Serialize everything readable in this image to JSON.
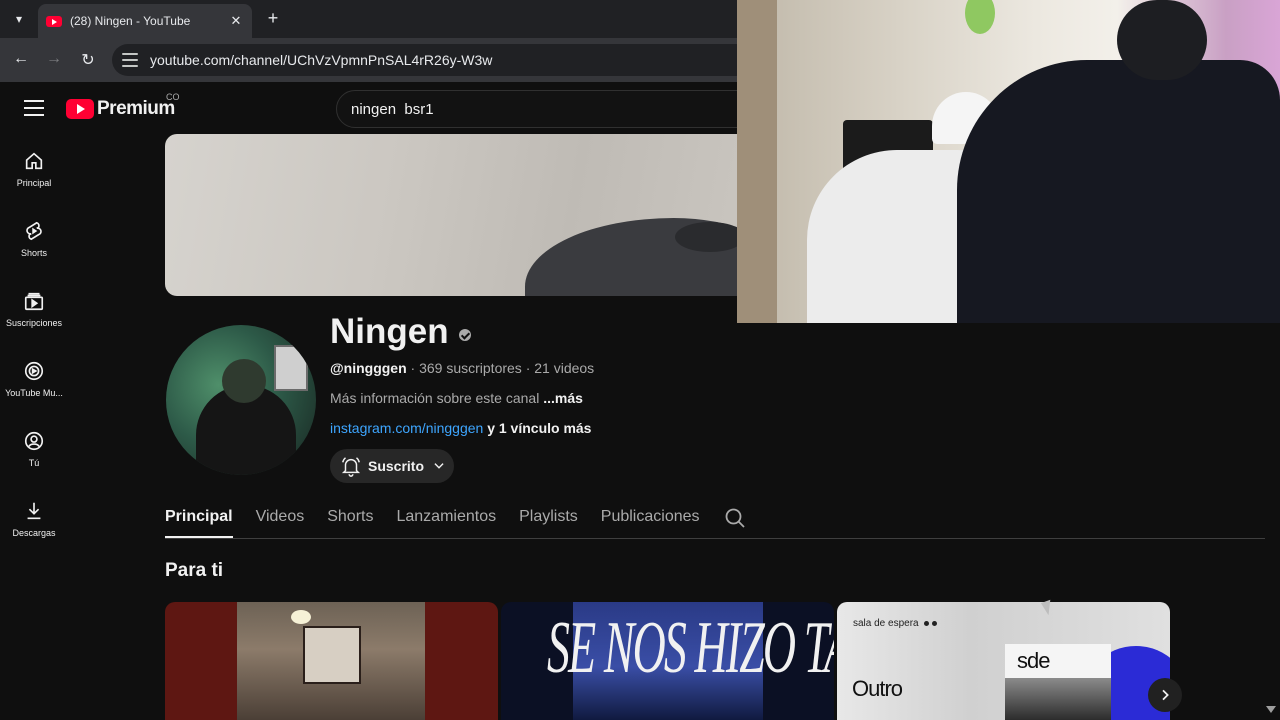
{
  "browser": {
    "tab_title": "(28) Ningen - YouTube",
    "tab_close": "✕",
    "new_tab": "+",
    "url": "youtube.com/channel/UChVzVpmnPnSAL4rR26y-W3w",
    "tab_menu_icon": "▾",
    "back_icon": "←",
    "forward_icon": "→",
    "reload_icon": "↻"
  },
  "header": {
    "logo_text": "Premium",
    "country_code": "CO",
    "search_value": "ningen  bsr1"
  },
  "guide": {
    "items": [
      {
        "label": "Principal",
        "icon": "home-icon"
      },
      {
        "label": "Shorts",
        "icon": "shorts-icon"
      },
      {
        "label": "Suscripciones",
        "icon": "subscriptions-icon"
      },
      {
        "label": "YouTube Mu...",
        "icon": "youtube-music-icon"
      },
      {
        "label": "Tú",
        "icon": "you-icon"
      },
      {
        "label": "Descargas",
        "icon": "downloads-icon"
      }
    ]
  },
  "channel": {
    "name": "Ningen",
    "handle": "@ningggen",
    "stats": " · 369 suscriptores · 21 videos",
    "about": "Más información sobre este canal ",
    "about_more": "...más",
    "link": "instagram.com/ningggen",
    "link_extra": " y 1 vínculo más",
    "subscribe_label": "Suscrito"
  },
  "tabs": [
    {
      "label": "Principal",
      "active": true
    },
    {
      "label": "Videos",
      "active": false
    },
    {
      "label": "Shorts",
      "active": false
    },
    {
      "label": "Lanzamientos",
      "active": false
    },
    {
      "label": "Playlists",
      "active": false
    },
    {
      "label": "Publicaciones",
      "active": false
    }
  ],
  "section": {
    "title": "Para ti"
  },
  "videos": [
    {
      "thumb_text": ""
    },
    {
      "thumb_text": "SE NOS HIZO TARDE"
    },
    {
      "thumb_label": "sala de espera",
      "thumb_title": "Outro",
      "card_text": "sde"
    }
  ],
  "colors": {
    "background": "#0f0f0f",
    "brand_red": "#ff0033",
    "link_blue": "#3ea6ff",
    "muted_text": "#aaaaaa"
  }
}
